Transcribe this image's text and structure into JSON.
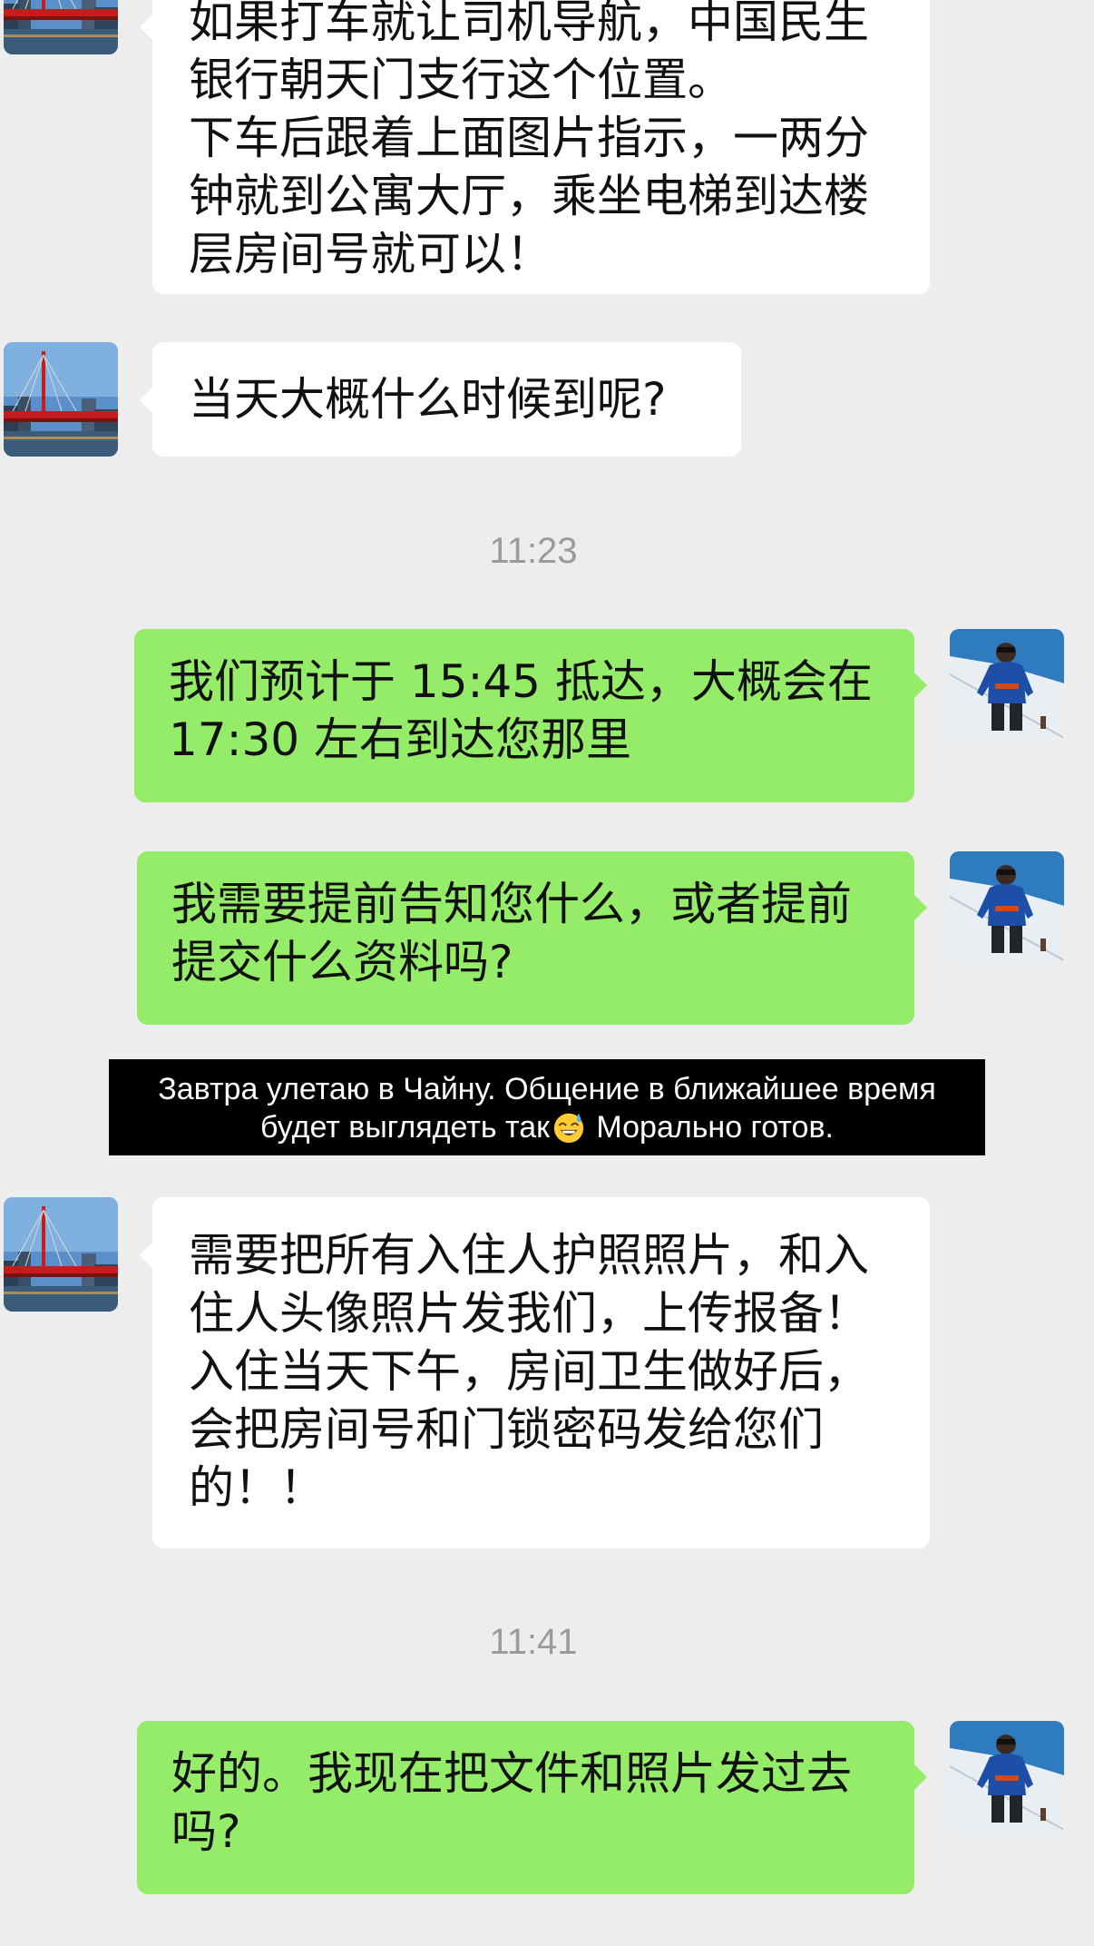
{
  "messages": [
    {
      "id": "m0",
      "side": "in",
      "text": "如果打车就让司机导航，中国民生\n银行朝天门支行这个位置。\n下车后跟着上面图片指示，一两分\n钟就到公寓大厅，乘坐电梯到达楼\n层房间号就可以！"
    },
    {
      "id": "m1",
      "side": "in",
      "text": "当天大概什么时候到呢?"
    },
    {
      "id": "m2",
      "side": "out",
      "text": "我们预计于 15:45 抵达，大概会在\n17:30 左右到达您那里"
    },
    {
      "id": "m3",
      "side": "out",
      "text": "我需要提前告知您什么，或者提前\n提交什么资料吗?"
    },
    {
      "id": "m4",
      "side": "in",
      "text": "需要把所有入住人护照照片，和入\n住人头像照片发我们，上传报备！\n入住当天下午，房间卫生做好后，\n会把房间号和门锁密码发给您们\n的！！"
    },
    {
      "id": "m5",
      "side": "out",
      "text": "好的。我现在把文件和照片发过去\n吗?"
    }
  ],
  "timestamps": [
    "11:23",
    "11:41"
  ],
  "caption": {
    "line1": "Завтра улетаю в Чайну. Общение в ближайшее время",
    "line2_before": "будет выглядеть так",
    "emoji": "grinning-sweat-emoji",
    "line2_after": " Морально готов."
  },
  "colors": {
    "background": "#ededed",
    "incoming_bubble": "#ffffff",
    "outgoing_bubble": "#95ec69",
    "timestamp_text": "#9a9a9a",
    "caption_bg": "#000000"
  },
  "avatars": {
    "contact": "bridge-city-avatar",
    "self": "mountain-climber-avatar"
  }
}
